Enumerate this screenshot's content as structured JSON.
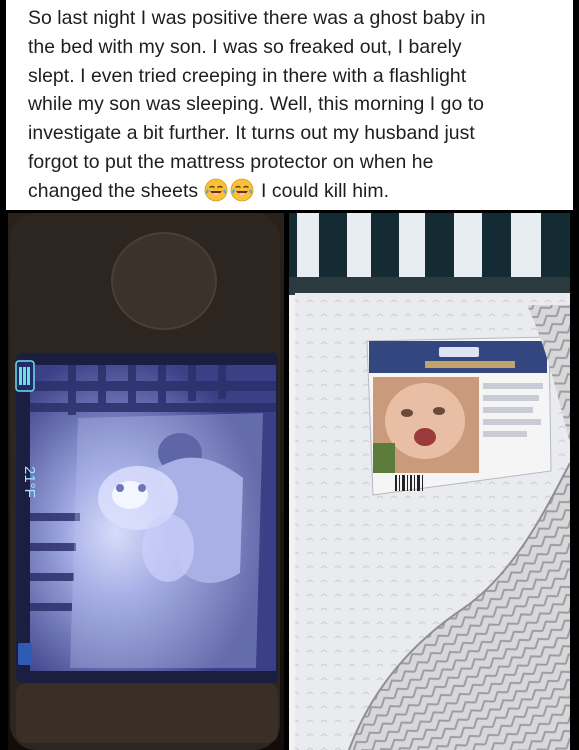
{
  "post": {
    "line_1": "So last night I was positive there was a ghost baby in",
    "line_2": "the bed with my son. I was so freaked out, I barely",
    "line_3": "slept. I even tried creeping in there with a flashlight",
    "line_4": "while my son was sleeping. Well, this morning I go to",
    "line_5": "investigate a bit further. It turns out my husband just",
    "line_6": "forgot to put the mattress protector on when he",
    "line_7_before_emoji": "changed the sheets",
    "line_7_after_emoji": "I could kill him.",
    "emoji": [
      "face-with-tears-of-joy-icon",
      "face-with-tears-of-joy-icon"
    ]
  },
  "photos": {
    "left": {
      "subject": "baby monitor screen showing crib at night",
      "monitor_readout": "21°F"
    },
    "right": {
      "subject": "crib mattress with printed baby photo packaging"
    }
  },
  "colors": {
    "page_background": "#000000",
    "post_background": "#ffffff",
    "text": "#1c1e21",
    "monitor_screen": "#8a93c8"
  }
}
